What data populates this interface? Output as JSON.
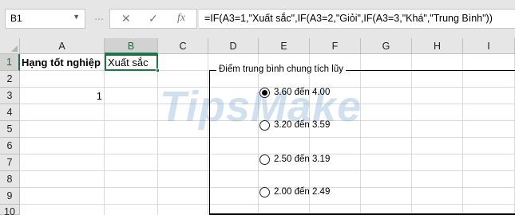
{
  "formula_bar": {
    "name_box": "B1",
    "cancel_icon": "✕",
    "enter_icon": "✓",
    "fx_label": "fx",
    "formula": "=IF(A3=1,\"Xuất sắc\",IF(A3=2,\"Giỏi\",IF(A3=3,\"Khá\",\"Trung Bình\"))"
  },
  "columns": [
    "A",
    "B",
    "C",
    "D",
    "E",
    "F",
    "G",
    "H",
    "I"
  ],
  "rows": [
    "1",
    "2",
    "3",
    "4",
    "5",
    "6",
    "7",
    "8",
    "9",
    "10"
  ],
  "cells": {
    "A1": "Hạng tốt nghiệp",
    "B1": "Xuất sắc",
    "A3": "1"
  },
  "group_box": {
    "title": "Điểm trung bình chung tích lũy",
    "options": [
      {
        "label": "3.60 đến 4.00",
        "selected": true
      },
      {
        "label": "3.20 đến 3.59",
        "selected": false
      },
      {
        "label": "2.50 đến 3.19",
        "selected": false
      },
      {
        "label": "2.00 đến 2.49",
        "selected": false
      }
    ]
  },
  "watermark": "TipsMake",
  "colors": {
    "accent": "#217346",
    "header_bg": "#e6e6e6",
    "gridline": "#d9d9d9"
  }
}
